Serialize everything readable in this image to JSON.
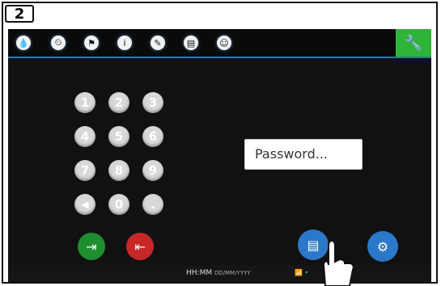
{
  "step": {
    "number": "2"
  },
  "topbar": {
    "icons": [
      "water-drop-icon",
      "clock-icon",
      "flag-icon",
      "info-icon",
      "pencil-icon",
      "document-icon",
      "user-icon",
      "wrench-icon"
    ]
  },
  "keypad": {
    "keys": [
      "1",
      "2",
      "3",
      "4",
      "5",
      "6",
      "7",
      "8",
      "9",
      "◀",
      "0",
      "."
    ]
  },
  "password": {
    "placeholder": "Password..."
  },
  "buttons": {
    "login": "login-door-icon",
    "logout": "logout-door-icon",
    "notes": "notes-icon",
    "user_settings": "user-settings-icon"
  },
  "status": {
    "time": "HH:MM",
    "date": "DD/MM/YYYY"
  }
}
